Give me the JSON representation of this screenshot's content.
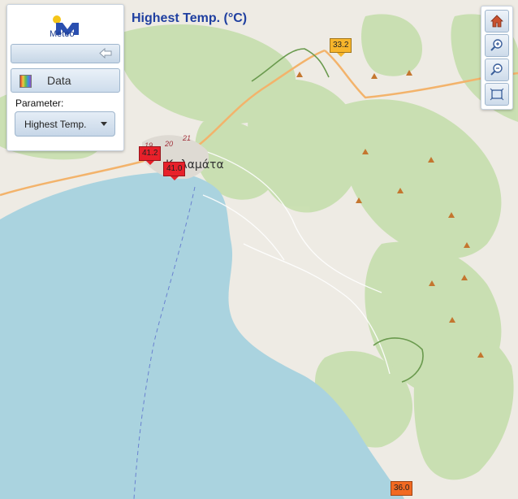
{
  "map": {
    "title": "Highest Temp. (°C)",
    "place_label": "Καλαμάτα",
    "road_numbers": [
      "19",
      "20",
      "21"
    ],
    "colors": {
      "land": "#eeebe4",
      "sea": "#aad3df",
      "forest": "#c8dfb0",
      "road_major": "#f3b36b",
      "border": "#6a9a4e"
    }
  },
  "panel": {
    "logo_text": "Meteo",
    "collapse_icon": "arrow-left-icon",
    "data_button_label": "Data",
    "parameter_label": "Parameter:",
    "parameter_value": "Highest Temp."
  },
  "toolbar": {
    "icons": [
      "home-icon",
      "zoom-in-icon",
      "zoom-out-icon",
      "full-extent-icon"
    ]
  },
  "markers": [
    {
      "value": "33.2",
      "color": "#f7b52b"
    },
    {
      "value": "41.2",
      "color": "#e8202a"
    },
    {
      "value": "41.0",
      "color": "#e8202a"
    },
    {
      "value": "36.0",
      "color": "#f26a21"
    }
  ]
}
